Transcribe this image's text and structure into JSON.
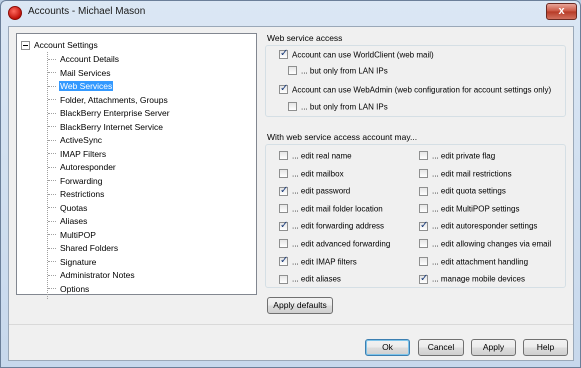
{
  "window": {
    "title": "Accounts - Michael Mason",
    "close_label": "x"
  },
  "tree": {
    "root": "Account Settings",
    "items": [
      {
        "label": "Account Details",
        "selected": false
      },
      {
        "label": "Mail Services",
        "selected": false
      },
      {
        "label": "Web Services",
        "selected": true
      },
      {
        "label": "Folder, Attachments, Groups",
        "selected": false
      },
      {
        "label": "BlackBerry Enterprise Server",
        "selected": false
      },
      {
        "label": "BlackBerry Internet Service",
        "selected": false
      },
      {
        "label": "ActiveSync",
        "selected": false
      },
      {
        "label": "IMAP Filters",
        "selected": false
      },
      {
        "label": "Autoresponder",
        "selected": false
      },
      {
        "label": "Forwarding",
        "selected": false
      },
      {
        "label": "Restrictions",
        "selected": false
      },
      {
        "label": "Quotas",
        "selected": false
      },
      {
        "label": "Aliases",
        "selected": false
      },
      {
        "label": "MultiPOP",
        "selected": false
      },
      {
        "label": "Shared Folders",
        "selected": false
      },
      {
        "label": "Signature",
        "selected": false
      },
      {
        "label": "Administrator Notes",
        "selected": false
      },
      {
        "label": "Options",
        "selected": false
      }
    ]
  },
  "web_access": {
    "title": "Web service access",
    "worldclient": {
      "label": "Account can use WorldClient (web mail)",
      "checked": true
    },
    "worldclient_lan": {
      "label": "... but only from LAN IPs",
      "checked": false
    },
    "webadmin": {
      "label": "Account can use WebAdmin (web configuration for account settings only)",
      "checked": true
    },
    "webadmin_lan": {
      "label": "... but only from LAN IPs",
      "checked": false
    }
  },
  "permissions": {
    "title": "With web service access account may...",
    "left": [
      {
        "label": "... edit real name",
        "checked": false
      },
      {
        "label": "... edit mailbox",
        "checked": false
      },
      {
        "label": "... edit password",
        "checked": true
      },
      {
        "label": "... edit mail folder location",
        "checked": false
      },
      {
        "label": "... edit forwarding address",
        "checked": true
      },
      {
        "label": "... edit advanced forwarding",
        "checked": false
      },
      {
        "label": "... edit IMAP filters",
        "checked": true
      },
      {
        "label": "... edit aliases",
        "checked": false
      }
    ],
    "right": [
      {
        "label": "... edit private flag",
        "checked": false
      },
      {
        "label": "... edit mail restrictions",
        "checked": false
      },
      {
        "label": "... edit quota settings",
        "checked": false
      },
      {
        "label": "... edit MultiPOP settings",
        "checked": false
      },
      {
        "label": "... edit autoresponder settings",
        "checked": true
      },
      {
        "label": "... edit allowing changes via email",
        "checked": false
      },
      {
        "label": "... edit attachment handling",
        "checked": false
      },
      {
        "label": "... manage mobile devices",
        "checked": true
      }
    ]
  },
  "buttons": {
    "apply_defaults": "Apply defaults",
    "ok": "Ok",
    "cancel": "Cancel",
    "apply": "Apply",
    "help": "Help"
  }
}
